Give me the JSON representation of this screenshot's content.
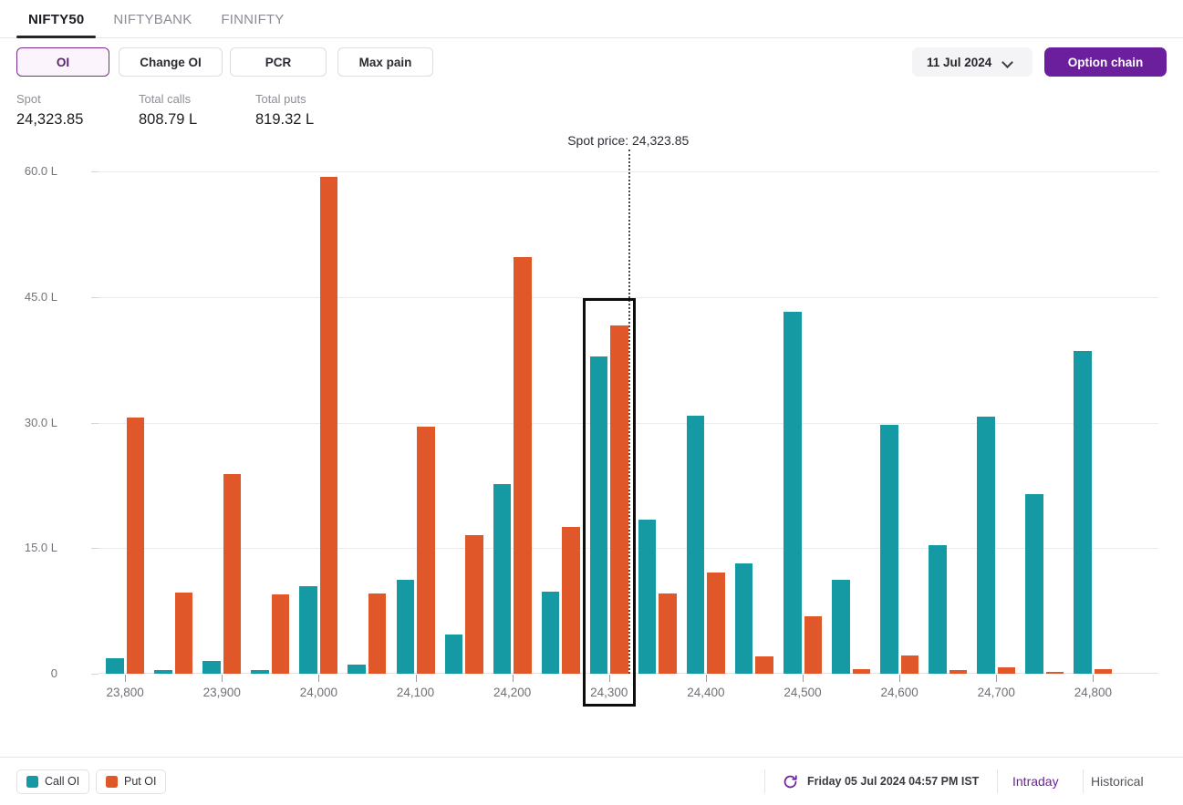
{
  "tabs": [
    {
      "label": "NIFTY50",
      "active": true
    },
    {
      "label": "NIFTYBANK",
      "active": false
    },
    {
      "label": "FINNIFTY",
      "active": false
    }
  ],
  "controls": {
    "oi_label": "OI",
    "change_oi_label": "Change OI",
    "pcr_label": "PCR",
    "max_pain_label": "Max pain",
    "expiry_value": "11 Jul 2024",
    "option_chain_label": "Option chain"
  },
  "stats": {
    "spot_label": "Spot",
    "spot_value": "24,323.85",
    "total_calls_label": "Total calls",
    "total_calls_value": "808.79 L",
    "total_puts_label": "Total puts",
    "total_puts_value": "819.32 L"
  },
  "footer": {
    "legend_call": "Call OI",
    "legend_put": "Put OI",
    "timestamp": "Friday 05 Jul 2024 04:57 PM IST",
    "intraday_label": "Intraday",
    "historical_label": "Historical"
  },
  "colors": {
    "call": "#1599a3",
    "put": "#e0572a",
    "accent": "#6c1f9c",
    "grid": "#ececec"
  },
  "chart_data": {
    "type": "bar",
    "title": "",
    "xlabel": "",
    "ylabel": "",
    "ylim": [
      0,
      60
    ],
    "yticks": [
      0,
      15,
      30,
      45,
      60
    ],
    "ytick_labels": [
      "0",
      "15.0 L",
      "30.0 L",
      "45.0 L",
      "60.0 L"
    ],
    "grid": true,
    "legend_position": "bottom-left",
    "unit": "L",
    "categories": [
      "23,800",
      "23,850",
      "23,900",
      "23,950",
      "24,000",
      "24,050",
      "24,100",
      "24,150",
      "24,200",
      "24,250",
      "24,300",
      "24,350",
      "24,400",
      "24,450",
      "24,500",
      "24,550",
      "24,600",
      "24,650",
      "24,700",
      "24,750",
      "24,800"
    ],
    "xtick_labels": [
      "23,800",
      "23,900",
      "24,000",
      "24,100",
      "24,200",
      "24,300",
      "24,400",
      "24,500",
      "24,600",
      "24,700",
      "24,800"
    ],
    "series": [
      {
        "name": "Call OI",
        "color": "#1599a3",
        "values": [
          1.9,
          0.4,
          1.5,
          0.4,
          10.5,
          1.1,
          11.2,
          4.7,
          22.6,
          9.8,
          37.9,
          18.4,
          30.8,
          13.2,
          43.2,
          11.2,
          29.7,
          15.4,
          30.7,
          21.5,
          38.5
        ]
      },
      {
        "name": "Put OI",
        "color": "#e0572a",
        "values": [
          30.6,
          9.7,
          23.9,
          9.5,
          59.3,
          9.6,
          29.5,
          16.5,
          49.8,
          17.5,
          41.6,
          9.6,
          12.1,
          2.1,
          6.9,
          0.6,
          2.2,
          0.4,
          0.8,
          0.2,
          0.6
        ]
      }
    ],
    "annotations": {
      "spot_line_label": "Spot price: 24,323.85",
      "spot_line_category_value": 24323.85,
      "selected_category": "24,300"
    }
  }
}
